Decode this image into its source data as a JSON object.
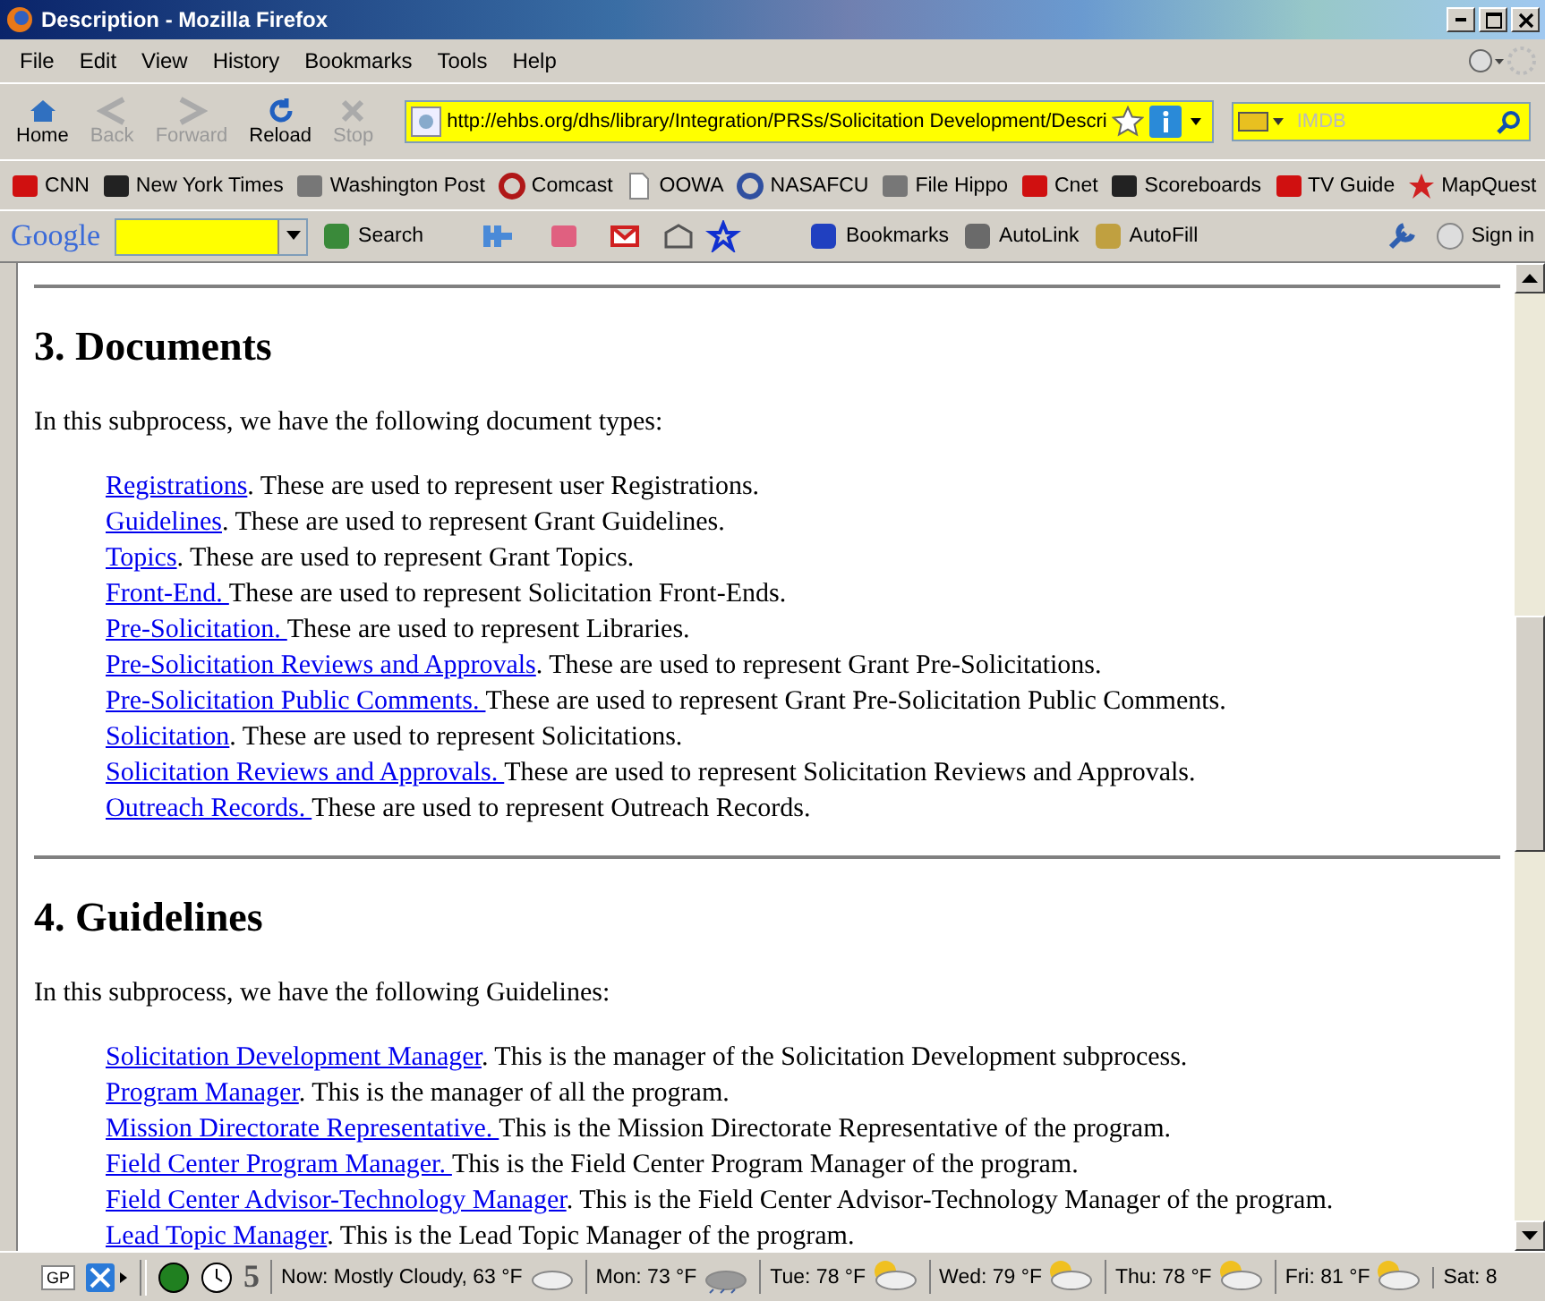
{
  "window": {
    "title": "Description - Mozilla Firefox"
  },
  "menu": [
    "File",
    "Edit",
    "View",
    "History",
    "Bookmarks",
    "Tools",
    "Help"
  ],
  "nav": [
    {
      "label": "Home",
      "kind": "home",
      "disabled": false
    },
    {
      "label": "Back",
      "kind": "back",
      "disabled": true
    },
    {
      "label": "Forward",
      "kind": "forward",
      "disabled": true
    },
    {
      "label": "Reload",
      "kind": "reload",
      "disabled": false
    },
    {
      "label": "Stop",
      "kind": "stop",
      "disabled": true
    }
  ],
  "address": {
    "value": "http://ehbs.org/dhs/library/Integration/PRSs/Solicitation Development/Descri"
  },
  "search": {
    "placeholder": "IMDB"
  },
  "bookmarks": [
    {
      "label": "CNN",
      "kind": "red"
    },
    {
      "label": "New York Times",
      "kind": "black"
    },
    {
      "label": "Washington Post",
      "kind": "grey"
    },
    {
      "label": "Comcast",
      "kind": "ring"
    },
    {
      "label": "OOWA",
      "kind": "page"
    },
    {
      "label": "NASAFCU",
      "kind": "globe"
    },
    {
      "label": "File Hippo",
      "kind": "grey"
    },
    {
      "label": "Cnet",
      "kind": "red"
    },
    {
      "label": "Scoreboards",
      "kind": "black"
    },
    {
      "label": "TV Guide",
      "kind": "red"
    },
    {
      "label": "MapQuest",
      "kind": "star"
    }
  ],
  "google_toolbar": {
    "logo": "Google",
    "items": [
      "Search",
      "Bookmarks",
      "AutoLink",
      "AutoFill"
    ],
    "sign_in": "Sign in"
  },
  "sections": [
    {
      "heading": "3. Documents",
      "intro": "In this subprocess, we have the following document types:",
      "items": [
        {
          "link": "Registrations",
          "text": ". These are used to represent user Registrations."
        },
        {
          "link": "Guidelines",
          "text": ". These are used to represent Grant Guidelines."
        },
        {
          "link": "Topics",
          "text": ". These are used to represent Grant Topics."
        },
        {
          "link": "Front-End. ",
          "text": "These are used to represent Solicitation Front-Ends."
        },
        {
          "link": "Pre-Solicitation. ",
          "text": "These are used to represent Libraries."
        },
        {
          "link": "Pre-Solicitation Reviews and Approvals",
          "text": ". These are used to represent Grant Pre-Solicitations."
        },
        {
          "link": "Pre-Solicitation Public Comments. ",
          "text": "These are used to represent Grant Pre-Solicitation Public Comments."
        },
        {
          "link": "Solicitation",
          "text": ". These are used to represent Solicitations."
        },
        {
          "link": "Solicitation Reviews and Approvals. ",
          "text": "These are used to represent Solicitation Reviews and Approvals."
        },
        {
          "link": "Outreach Records. ",
          "text": "These are used to represent Outreach Records."
        }
      ]
    },
    {
      "heading": "4. Guidelines",
      "intro": "In this subprocess, we have the following Guidelines:",
      "items": [
        {
          "link": "Solicitation Development Manager",
          "text": ". This is the manager of the Solicitation Development subprocess."
        },
        {
          "link": "Program Manager",
          "text": ". This is the manager of all the program."
        },
        {
          "link": "Mission Directorate Representative. ",
          "text": "This is the Mission Directorate Representative of the program."
        },
        {
          "link": "Field Center Program Manager. ",
          "text": "This is the Field Center Program Manager of the program."
        },
        {
          "link": "Field Center Advisor-Technology Manager",
          "text": ". This is the Field Center Advisor-Technology Manager of the program."
        },
        {
          "link": "Lead Topic Manager",
          "text": ". This is the Lead Topic Manager of the program."
        }
      ]
    }
  ],
  "status_bar": {
    "gp": "GP",
    "count": "5",
    "weather": [
      {
        "label": "Now: Mostly Cloudy, 63 °F",
        "kind": "cloud"
      },
      {
        "label": "Mon: 73 °F",
        "kind": "rain"
      },
      {
        "label": "Tue: 78 °F",
        "kind": "suncloud"
      },
      {
        "label": "Wed: 79 °F",
        "kind": "suncloud"
      },
      {
        "label": "Thu: 78 °F",
        "kind": "suncloud"
      },
      {
        "label": "Fri: 81 °F",
        "kind": "suncloud"
      },
      {
        "label": "Sat: 8",
        "kind": "none"
      }
    ]
  }
}
